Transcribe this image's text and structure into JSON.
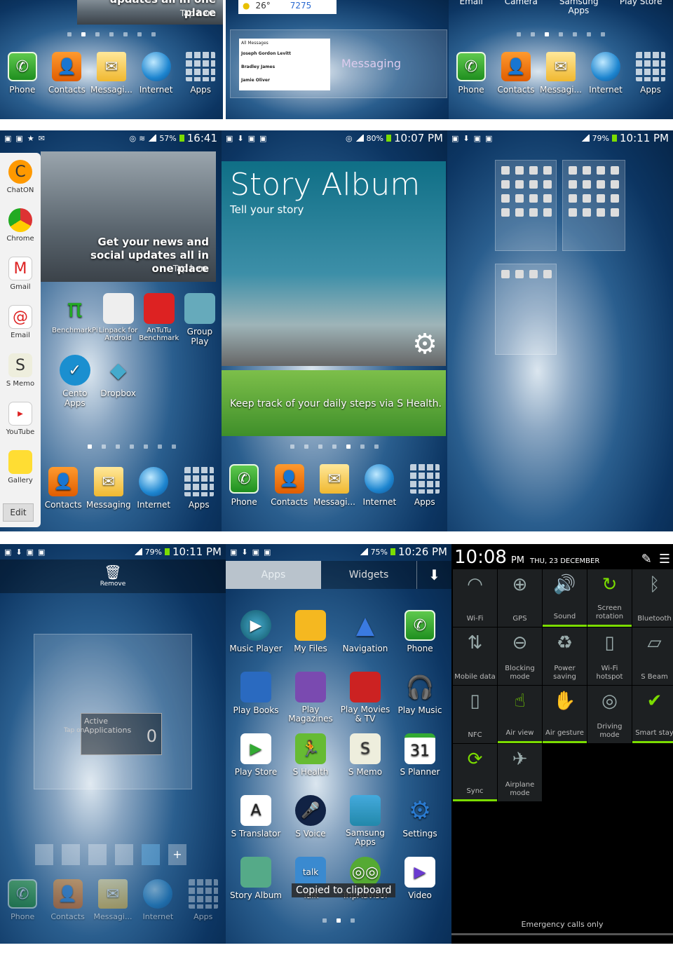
{
  "top": {
    "left": {
      "dock": [
        "Phone",
        "Contacts",
        "Messagi...",
        "Internet",
        "Apps"
      ],
      "news_caption": "updates all in one place",
      "tap": "Tap here"
    },
    "middle": {
      "weather_temp": "26°",
      "stock": "7275",
      "messaging_label": "Messaging",
      "messages": [
        "All Messages",
        "Joseph Gordon Levitt",
        "Bradley James",
        "Jamie Oliver"
      ]
    },
    "right": {
      "top_labels": [
        "Email",
        "Camera",
        "Samsung Apps",
        "Play Store"
      ],
      "dock": [
        "Phone",
        "Contacts",
        "Messagi...",
        "Internet",
        "Apps"
      ]
    }
  },
  "middle_row": {
    "p1": {
      "battery": "57%",
      "time": "16:41",
      "sidebar": [
        "ChatON",
        "Chrome",
        "Gmail",
        "Email",
        "S Memo",
        "YouTube",
        "Gallery"
      ],
      "edit": "Edit",
      "news_title": "Get your news and social updates all in one place",
      "tap": "Tap here",
      "apps": [
        "BenchmarkPi",
        "Linpack for Android",
        "AnTuTu Benchmark",
        "Group Play",
        "Cento Apps",
        "Dropbox"
      ],
      "dock": [
        "Contacts",
        "Messaging",
        "Internet",
        "Apps"
      ]
    },
    "p2": {
      "battery": "80%",
      "time": "10:07 PM",
      "story_title": "Story Album",
      "story_sub": "Tell your story",
      "health": "Keep track of your daily steps via S Health.",
      "dock": [
        "Phone",
        "Contacts",
        "Messagi...",
        "Internet",
        "Apps"
      ]
    },
    "p3": {
      "battery": "79%",
      "time": "10:11 PM"
    }
  },
  "bottom_row": {
    "p1": {
      "battery": "79%",
      "time": "10:11 PM",
      "remove": "Remove",
      "active": "Active Applications",
      "tap": "Tap on",
      "count": "0",
      "dock": [
        "Phone",
        "Contacts",
        "Messagi...",
        "Internet",
        "Apps"
      ]
    },
    "p2": {
      "battery": "75%",
      "time": "10:26 PM",
      "tab_apps": "Apps",
      "tab_widgets": "Widgets",
      "apps": [
        "Music Player",
        "My Files",
        "Navigation",
        "Phone",
        "Play Books",
        "Play Magazines",
        "Play Movies & TV",
        "Play Music",
        "Play Store",
        "S Health",
        "S Memo",
        "S Planner",
        "S Translator",
        "S Voice",
        "Samsung Apps",
        "Settings",
        "Story Album",
        "Talk",
        "TripAdvisor",
        "Video"
      ],
      "toast": "Copied to clipboard"
    },
    "p3": {
      "time": "10:08",
      "ampm": "PM",
      "date": "THU, 23 DECEMBER",
      "tiles": [
        "Wi-Fi",
        "GPS",
        "Sound",
        "Screen rotation",
        "Bluetooth",
        "Mobile data",
        "Blocking mode",
        "Power saving",
        "Wi-Fi hotspot",
        "S Beam",
        "NFC",
        "Air view",
        "Air gesture",
        "Driving mode",
        "Smart stay",
        "Sync",
        "Airplane mode"
      ],
      "emergency": "Emergency calls only"
    }
  },
  "colors": {
    "accent": "#7bdc00",
    "wallpaper": "#0c3562"
  }
}
